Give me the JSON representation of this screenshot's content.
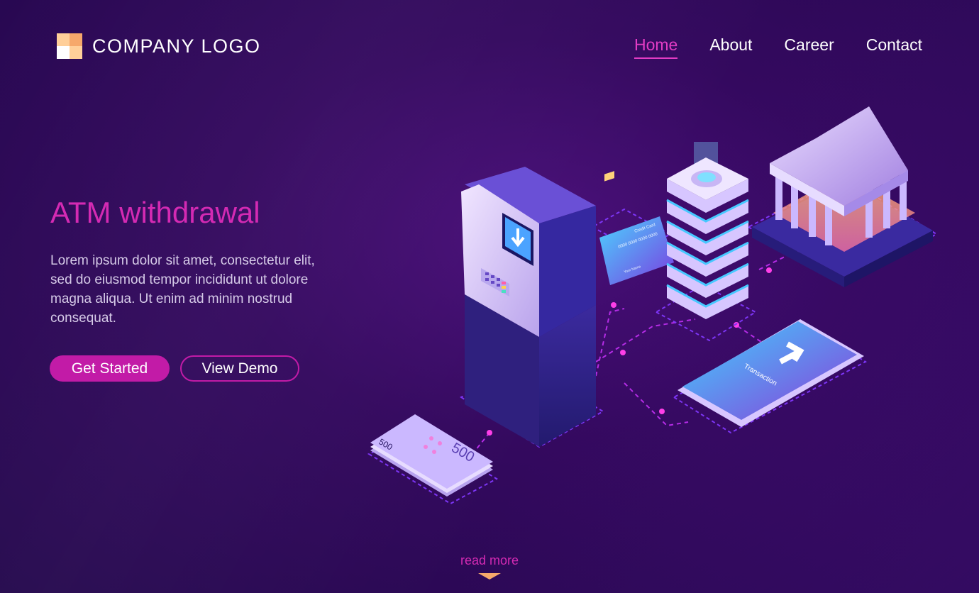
{
  "header": {
    "logo_text": "COMPANY LOGO",
    "nav": [
      {
        "label": "Home",
        "active": true
      },
      {
        "label": "About",
        "active": false
      },
      {
        "label": "Career",
        "active": false
      },
      {
        "label": "Contact",
        "active": false
      }
    ]
  },
  "hero": {
    "title": "ATM withdrawal",
    "description": "Lorem ipsum dolor sit amet, consectetur elit, sed do eiusmod tempor incididunt ut dolore magna aliqua. Ut enim ad minim nostrud consequat.",
    "primary_button": "Get Started",
    "secondary_button": "View Demo"
  },
  "illustration": {
    "card_text": "Credit Card",
    "card_number": "0000 0000 0000 0000",
    "card_name": "Your Name",
    "phone_text": "Transaction",
    "banknote_value": "500",
    "icons": [
      "atm-machine",
      "server",
      "bank",
      "credit-card",
      "smartphone",
      "banknotes"
    ]
  },
  "footer": {
    "read_more": "read more"
  },
  "colors": {
    "accent": "#d42ab3",
    "button": "#c21ba7",
    "background": "#34095f",
    "logo_orange": "#f6a86b"
  }
}
